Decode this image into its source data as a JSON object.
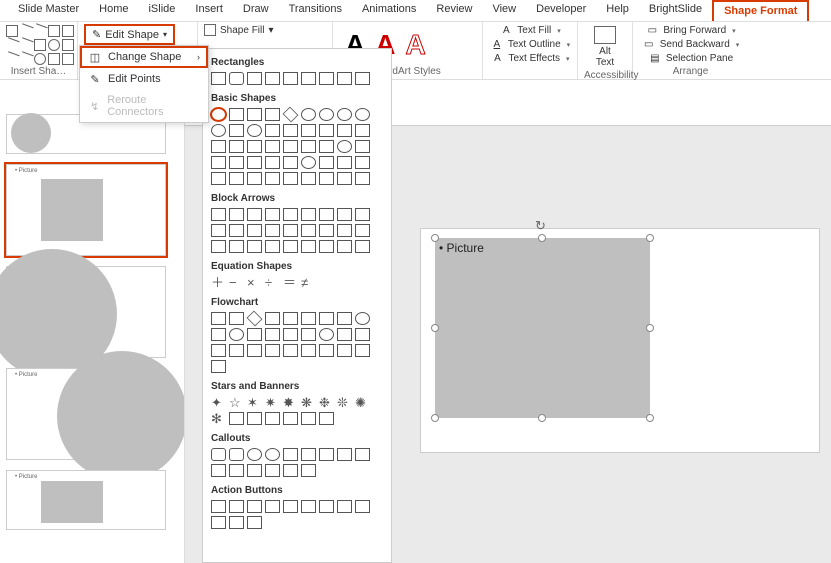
{
  "ribbon_tabs": {
    "slide_master": "Slide Master",
    "home": "Home",
    "islide": "iSlide",
    "insert": "Insert",
    "draw": "Draw",
    "transitions": "Transitions",
    "animations": "Animations",
    "review": "Review",
    "view": "View",
    "developer": "Developer",
    "help": "Help",
    "brightslide": "BrightSlide",
    "shape_format": "Shape Format"
  },
  "groups": {
    "insert_shapes": "Insert Sha…",
    "wordart_styles": "WordArt Styles",
    "accessibility": "Accessibility",
    "arrange": "Arrange"
  },
  "edit_shape": {
    "label": "Edit Shape",
    "change_shape": "Change Shape",
    "edit_points": "Edit Points",
    "reroute_connectors": "Reroute Connectors"
  },
  "shape_style": {
    "shape_fill": "Shape Fill"
  },
  "wordart": {
    "a": "A"
  },
  "text_group": {
    "text_fill": "Text Fill",
    "text_outline": "Text Outline",
    "text_effects": "Text Effects"
  },
  "alt_text": "Alt Text",
  "arrange": {
    "bring_forward": "Bring Forward",
    "send_backward": "Send Backward",
    "selection_pane": "Selection Pane"
  },
  "gallery": {
    "rectangles": "Rectangles",
    "basic_shapes": "Basic Shapes",
    "block_arrows": "Block Arrows",
    "equation_shapes": "Equation Shapes",
    "flowchart": "Flowchart",
    "stars_and_banners": "Stars and Banners",
    "callouts": "Callouts",
    "action_buttons": "Action Buttons"
  },
  "canvas": {
    "placeholder_label": "Picture",
    "thumb_label_picture": "Picture",
    "thumb_label_section": "• Picture"
  }
}
